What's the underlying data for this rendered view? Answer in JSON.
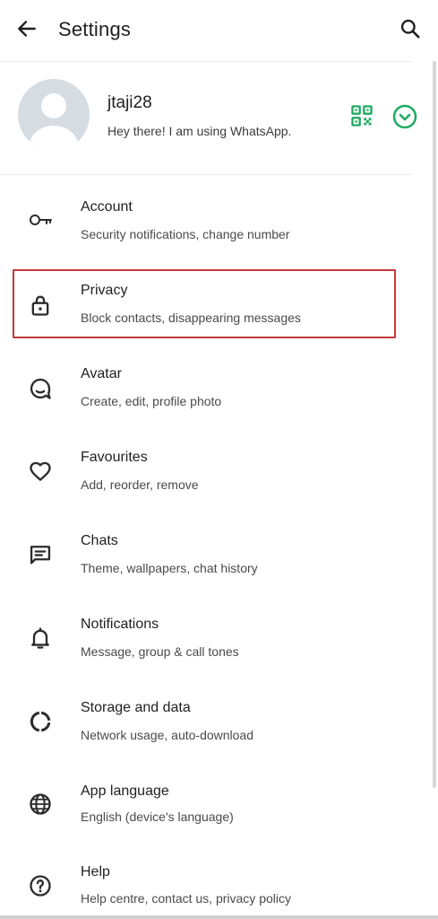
{
  "appbar": {
    "title": "Settings",
    "back_icon": "arrow-back-icon",
    "search_icon": "search-icon"
  },
  "profile": {
    "name": "jtaji28",
    "status": "Hey there! I am using WhatsApp.",
    "qr_icon": "qr-code-icon",
    "expand_icon": "chevron-down-circle-icon"
  },
  "colors": {
    "accent": "#1daa61",
    "highlight_border": "#c23a3a",
    "icon": "#2b2b2b"
  },
  "settings": [
    {
      "key": "account",
      "title": "Account",
      "subtitle": "Security notifications, change number",
      "icon": "key-icon"
    },
    {
      "key": "privacy",
      "title": "Privacy",
      "subtitle": "Block contacts, disappearing messages",
      "icon": "lock-icon",
      "highlighted": true
    },
    {
      "key": "avatar",
      "title": "Avatar",
      "subtitle": "Create, edit, profile photo",
      "icon": "avatar-face-icon"
    },
    {
      "key": "favourites",
      "title": "Favourites",
      "subtitle": "Add, reorder, remove",
      "icon": "heart-icon"
    },
    {
      "key": "chats",
      "title": "Chats",
      "subtitle": "Theme, wallpapers, chat history",
      "icon": "chat-icon"
    },
    {
      "key": "notifications",
      "title": "Notifications",
      "subtitle": "Message, group & call tones",
      "icon": "bell-icon"
    },
    {
      "key": "storage",
      "title": "Storage and data",
      "subtitle": "Network usage, auto-download",
      "icon": "storage-ring-icon"
    },
    {
      "key": "language",
      "title": "App language",
      "subtitle": "English (device's language)",
      "icon": "globe-icon"
    },
    {
      "key": "help",
      "title": "Help",
      "subtitle": "Help centre, contact us, privacy policy",
      "icon": "help-circle-icon"
    }
  ]
}
